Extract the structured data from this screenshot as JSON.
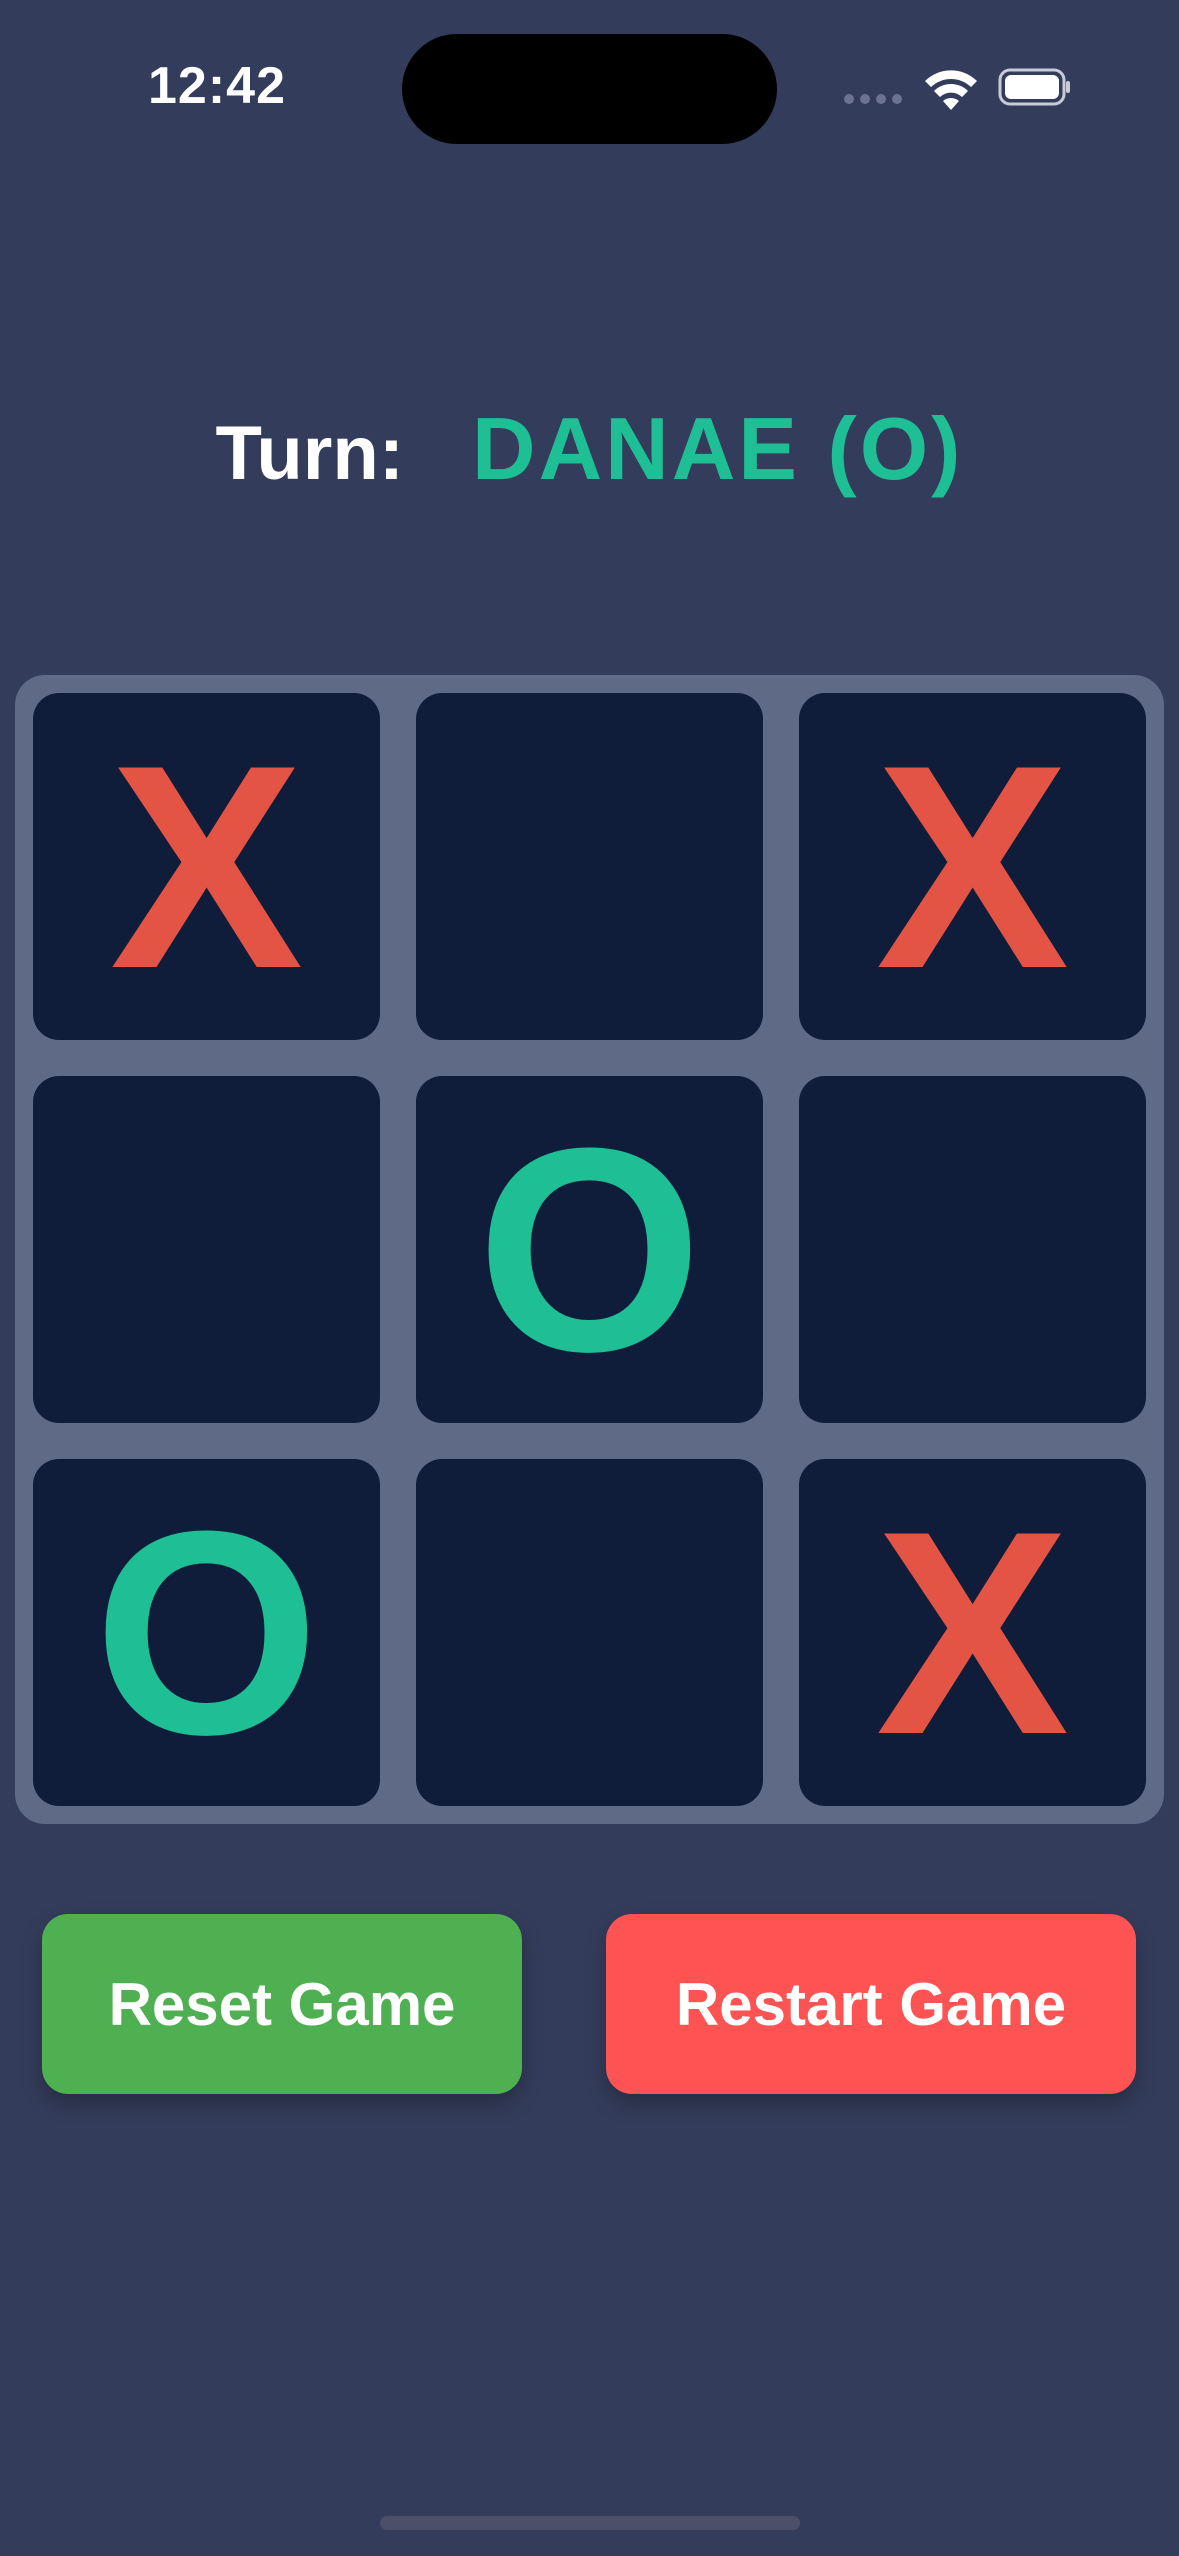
{
  "status_bar": {
    "time": "12:42"
  },
  "turn": {
    "label": "Turn:",
    "player": "DANAE (O)",
    "player_color": "#1fbf95"
  },
  "board": {
    "cells": [
      "X",
      "",
      "X",
      "",
      "O",
      "",
      "O",
      "",
      "X"
    ],
    "x_color": "#e35444",
    "o_color": "#1fbf95"
  },
  "buttons": {
    "reset_label": "Reset Game",
    "reset_color": "#4fb052",
    "restart_label": "Restart Game",
    "restart_color": "#fe5353"
  },
  "icons": [
    "signal-icon",
    "wifi-icon",
    "battery-icon"
  ]
}
